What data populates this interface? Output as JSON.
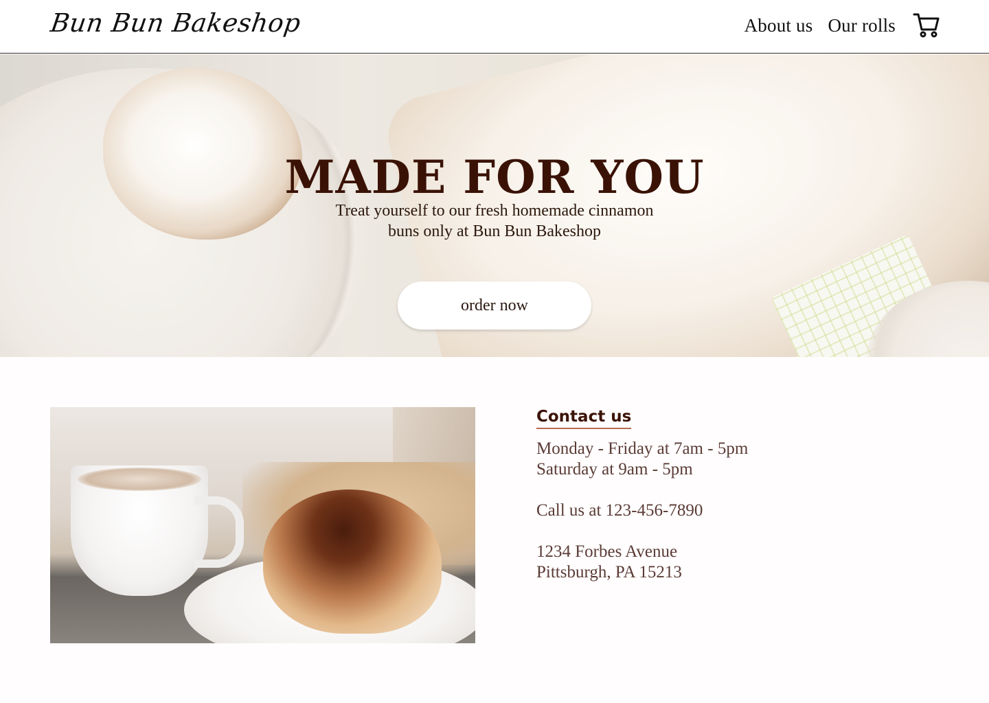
{
  "header": {
    "logo_text": "Bun Bun Bakeshop",
    "nav": [
      {
        "label": "About us"
      },
      {
        "label": "Our rolls"
      }
    ],
    "cart_icon": "shopping-cart-icon"
  },
  "hero": {
    "title": "MADE FOR YOU",
    "subtitle_line1": "Treat yourself to our fresh homemade cinnamon",
    "subtitle_line2": "buns only at Bun Bun Bakeshop",
    "cta_label": "order now"
  },
  "contact": {
    "heading": "Contact us",
    "hours_weekday": "Monday - Friday at 7am - 5pm",
    "hours_saturday": "Saturday at 9am - 5pm",
    "phone": "Call us at 123-456-7890",
    "address_line1": "1234 Forbes Avenue",
    "address_line2": "Pittsburgh, PA 15213"
  },
  "colors": {
    "title": "#3a1205",
    "heading_underline": "#b86a53",
    "contact_text": "#5a3b36"
  }
}
